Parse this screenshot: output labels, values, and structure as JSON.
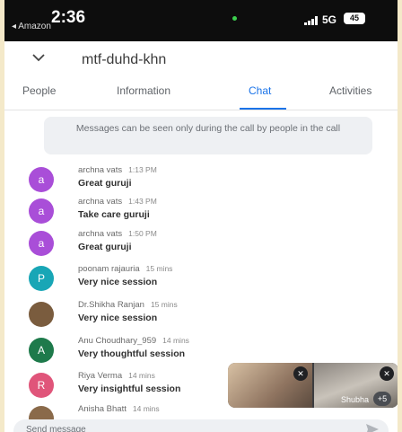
{
  "status_bar": {
    "time": "2:36",
    "back_app": "◂ Amazon",
    "network": "5G",
    "battery": "45"
  },
  "header": {
    "meeting_code": "mtf-duhd-khn"
  },
  "tabs": [
    {
      "label": "People"
    },
    {
      "label": "Information"
    },
    {
      "label": "Chat"
    },
    {
      "label": "Activities"
    }
  ],
  "active_tab": "Chat",
  "notice": "Messages can be seen only during the call by people in the call",
  "messages": [
    {
      "initial": "a",
      "color": "#a94ed8",
      "sender": "archna vats",
      "time": "1:13 PM",
      "text": "Great guruji"
    },
    {
      "initial": "a",
      "color": "#a94ed8",
      "sender": "archna vats",
      "time": "1:43 PM",
      "text": "Take care guruji"
    },
    {
      "initial": "a",
      "color": "#a94ed8",
      "sender": "archna vats",
      "time": "1:50 PM",
      "text": "Great guruji"
    },
    {
      "initial": "P",
      "color": "#18a6b6",
      "sender": "poonam rajauria",
      "time": "15 mins",
      "text": "Very nice session"
    },
    {
      "initial": "",
      "color": "#7a5c3e",
      "sender": "Dr.Shikha Ranjan",
      "time": "15 mins",
      "text": "Very nice session"
    },
    {
      "initial": "A",
      "color": "#1e7a4b",
      "sender": "Anu Choudhary_959",
      "time": "14 mins",
      "text": "Very thoughtful session"
    },
    {
      "initial": "R",
      "color": "#e0557a",
      "sender": "Riya Verma",
      "time": "14 mins",
      "text": "Very insightful session"
    },
    {
      "initial": "",
      "color": "#8a6a4a",
      "sender": "Anisha Bhatt",
      "time": "14 mins",
      "text": ""
    }
  ],
  "pip": {
    "tile_name": "Shubha",
    "more_count": "+5"
  },
  "composer": {
    "placeholder": "Send message"
  }
}
